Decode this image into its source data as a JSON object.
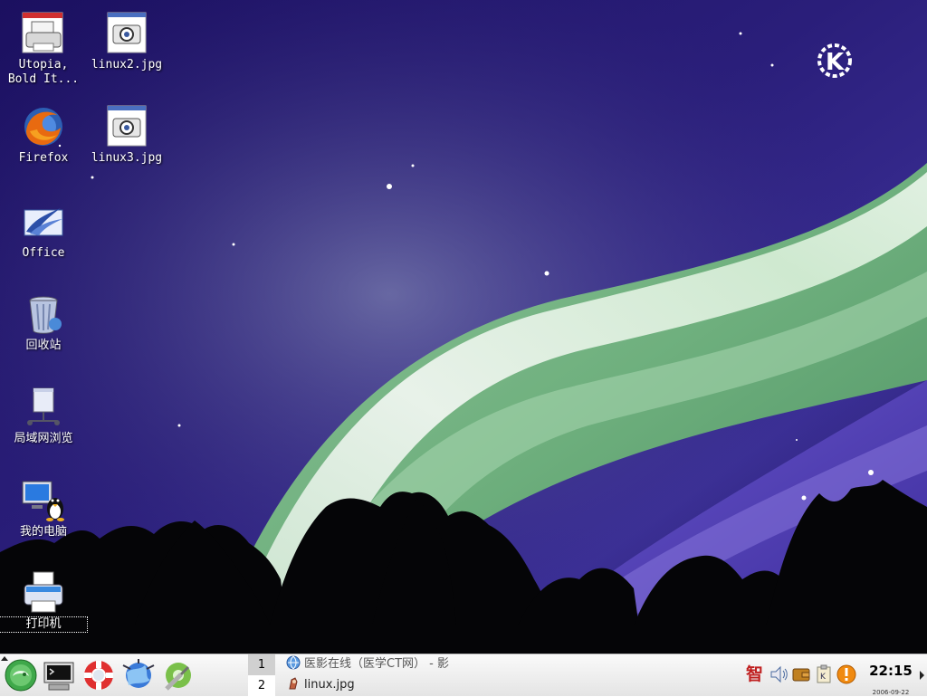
{
  "desktop": {
    "icons": [
      {
        "name": "printer-utopia",
        "label": "Utopia,\nBold It...",
        "icon": "printer-icon"
      },
      {
        "name": "linux2-jpg",
        "label": "linux2.jpg",
        "icon": "image-file-icon"
      },
      {
        "name": "firefox",
        "label": "Firefox",
        "icon": "firefox-icon"
      },
      {
        "name": "linux3-jpg",
        "label": "linux3.jpg",
        "icon": "image-file-icon"
      },
      {
        "name": "office",
        "label": "Office",
        "icon": "office-icon"
      },
      {
        "name": "trash",
        "label": "回收站",
        "icon": "trash-icon"
      },
      {
        "name": "network-browse",
        "label": "局域网浏览",
        "icon": "network-icon"
      },
      {
        "name": "my-computer",
        "label": "我的电脑",
        "icon": "computer-icon"
      },
      {
        "name": "printers",
        "label": "打印机",
        "icon": "printer-icon"
      }
    ]
  },
  "taskbar": {
    "launchers": [
      "suse-menu-icon",
      "terminal-icon",
      "help-lifebuoy-icon",
      "web-browser-icon",
      "control-center-icon"
    ],
    "pager": [
      "1",
      "2"
    ],
    "tasks": [
      {
        "label": "医影在线（医学CT网） - 影",
        "icon": "browser-globe-icon"
      },
      {
        "label": "linux.jpg",
        "icon": "image-viewer-icon"
      }
    ],
    "tray": [
      "input-method-icon",
      "volume-icon",
      "wallet-icon",
      "klipper-icon",
      "update-alert-icon"
    ],
    "tray_input_glyph": "智",
    "clock_time": "22:15",
    "clock_date": "2006-09-22"
  },
  "colors": {
    "panel": "#eaeaea",
    "sky_dark": "#1a0f5c",
    "aurora_green": "#7fc08a",
    "aurora_white": "#eef6ee"
  }
}
